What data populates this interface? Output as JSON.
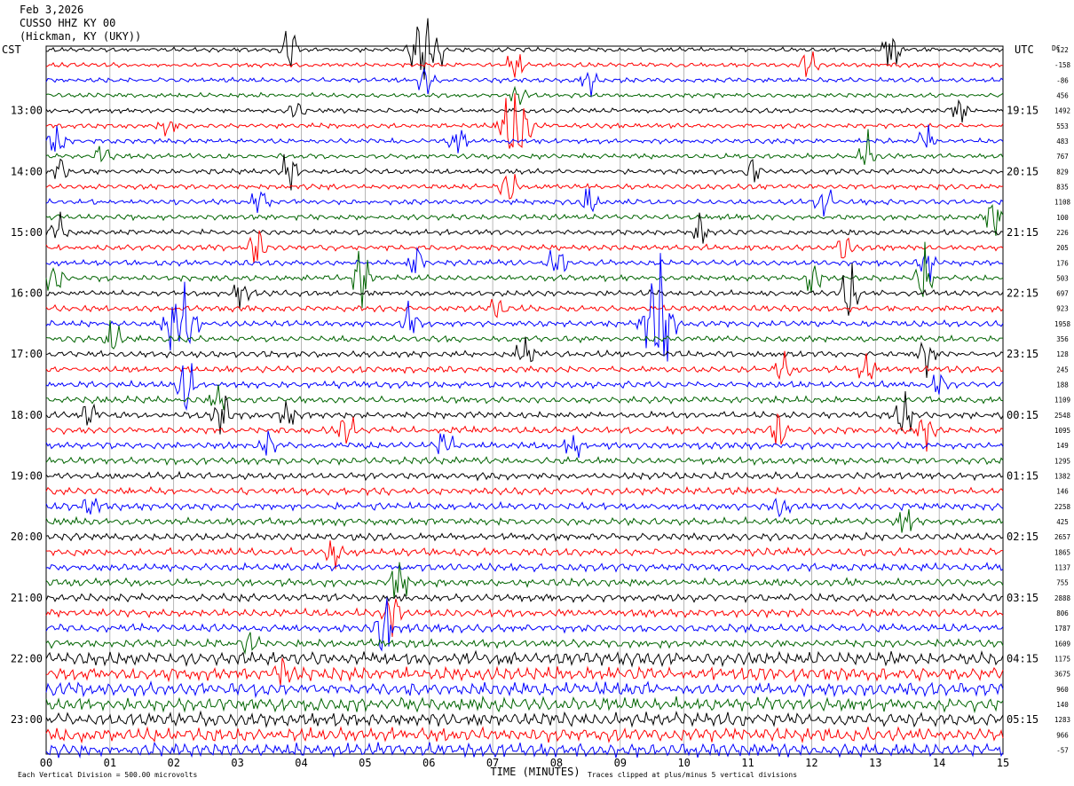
{
  "header": {
    "date": "Feb 3,2026",
    "station": "CUSSO HHZ KY 00",
    "location": "(Hickman, KY (UKY))"
  },
  "labels": {
    "left_zone": "CST",
    "right_zone": "UTC",
    "dc_header": "DC",
    "xlabel": "TIME (MINUTES)",
    "footer_left": "Each Vertical Division =  500.00 microvolts",
    "footer_right": "Traces clipped at plus/minus 5 vertical divisions"
  },
  "chart_data": {
    "type": "line",
    "title": "",
    "xlabel": "TIME (MINUTES)",
    "xlim": [
      0,
      15
    ],
    "x_ticks": [
      "00",
      "01",
      "02",
      "03",
      "04",
      "05",
      "06",
      "07",
      "08",
      "09",
      "10",
      "11",
      "12",
      "13",
      "14",
      "15"
    ],
    "trace_colors": [
      "#000000",
      "#ff0000",
      "#0000ff",
      "#006400"
    ],
    "left_hour_labels": [
      {
        "row": 4,
        "label": "13:00"
      },
      {
        "row": 8,
        "label": "14:00"
      },
      {
        "row": 12,
        "label": "15:00"
      },
      {
        "row": 16,
        "label": "16:00"
      },
      {
        "row": 20,
        "label": "17:00"
      },
      {
        "row": 24,
        "label": "18:00"
      },
      {
        "row": 28,
        "label": "19:00"
      },
      {
        "row": 32,
        "label": "20:00"
      },
      {
        "row": 36,
        "label": "21:00"
      },
      {
        "row": 40,
        "label": "22:00"
      },
      {
        "row": 44,
        "label": "23:00"
      }
    ],
    "right_hour_labels": [
      {
        "row": 4,
        "label": "19:15"
      },
      {
        "row": 8,
        "label": "20:15"
      },
      {
        "row": 12,
        "label": "21:15"
      },
      {
        "row": 16,
        "label": "22:15"
      },
      {
        "row": 20,
        "label": "23:15"
      },
      {
        "row": 24,
        "label": "00:15"
      },
      {
        "row": 28,
        "label": "01:15"
      },
      {
        "row": 32,
        "label": "02:15"
      },
      {
        "row": 36,
        "label": "03:15"
      },
      {
        "row": 40,
        "label": "04:15"
      },
      {
        "row": 44,
        "label": "05:15"
      }
    ],
    "dc_offsets": [
      "122",
      "-158",
      "-86",
      "456",
      "1492",
      "553",
      "483",
      "767",
      "829",
      "835",
      "1108",
      "100",
      "226",
      "205",
      "176",
      "503",
      "697",
      "923",
      "1958",
      "356",
      "128",
      "245",
      "188",
      "1109",
      "2548",
      "1095",
      "149",
      "1295",
      "1382",
      "146",
      "2258",
      "425",
      "2657",
      "1865",
      "1137",
      "755",
      "2888",
      "806",
      "1787",
      "1609",
      "1175",
      "3675",
      "960",
      "140",
      "1283",
      "966",
      "-57"
    ],
    "traces_count": 47,
    "events": [
      {
        "row": 0,
        "minute": 3.8,
        "amp": 2.5
      },
      {
        "row": 0,
        "minute": 5.95,
        "amp": 3.0
      },
      {
        "row": 0,
        "minute": 13.25,
        "amp": 2.0
      },
      {
        "row": 1,
        "minute": 7.35,
        "amp": 1.5
      },
      {
        "row": 1,
        "minute": 11.95,
        "amp": 1.2
      },
      {
        "row": 2,
        "minute": 5.95,
        "amp": 1.2
      },
      {
        "row": 2,
        "minute": 8.5,
        "amp": 1.5
      },
      {
        "row": 3,
        "minute": 7.4,
        "amp": 1.0
      },
      {
        "row": 4,
        "minute": 3.95,
        "amp": 1.4
      },
      {
        "row": 4,
        "minute": 14.3,
        "amp": 1.0
      },
      {
        "row": 5,
        "minute": 1.9,
        "amp": 1.0
      },
      {
        "row": 5,
        "minute": 7.35,
        "amp": 3.5
      },
      {
        "row": 6,
        "minute": 0.15,
        "amp": 1.2
      },
      {
        "row": 6,
        "minute": 6.45,
        "amp": 1.2
      },
      {
        "row": 6,
        "minute": 13.8,
        "amp": 1.5
      },
      {
        "row": 7,
        "minute": 0.9,
        "amp": 1.0
      },
      {
        "row": 7,
        "minute": 12.85,
        "amp": 1.8
      },
      {
        "row": 8,
        "minute": 0.2,
        "amp": 1.5
      },
      {
        "row": 8,
        "minute": 3.8,
        "amp": 1.6
      },
      {
        "row": 8,
        "minute": 11.1,
        "amp": 1.2
      },
      {
        "row": 9,
        "minute": 7.25,
        "amp": 1.4
      },
      {
        "row": 10,
        "minute": 3.35,
        "amp": 1.4
      },
      {
        "row": 10,
        "minute": 8.5,
        "amp": 1.4
      },
      {
        "row": 10,
        "minute": 12.2,
        "amp": 1.6
      },
      {
        "row": 11,
        "minute": 14.85,
        "amp": 1.4
      },
      {
        "row": 12,
        "minute": 0.2,
        "amp": 1.4
      },
      {
        "row": 12,
        "minute": 10.25,
        "amp": 1.5
      },
      {
        "row": 13,
        "minute": 3.3,
        "amp": 2.0
      },
      {
        "row": 13,
        "minute": 12.5,
        "amp": 1.2
      },
      {
        "row": 14,
        "minute": 5.8,
        "amp": 1.6
      },
      {
        "row": 14,
        "minute": 8.0,
        "amp": 1.6
      },
      {
        "row": 14,
        "minute": 13.8,
        "amp": 1.4
      },
      {
        "row": 15,
        "minute": 0.15,
        "amp": 1.6
      },
      {
        "row": 15,
        "minute": 4.95,
        "amp": 2.5
      },
      {
        "row": 15,
        "minute": 12.0,
        "amp": 1.4
      },
      {
        "row": 15,
        "minute": 13.75,
        "amp": 2.6
      },
      {
        "row": 16,
        "minute": 3.05,
        "amp": 1.2
      },
      {
        "row": 16,
        "minute": 12.6,
        "amp": 2.0
      },
      {
        "row": 17,
        "minute": 7.1,
        "amp": 1.2
      },
      {
        "row": 18,
        "minute": 5.7,
        "amp": 1.6
      },
      {
        "row": 18,
        "minute": 9.6,
        "amp": 5.0
      },
      {
        "row": 18,
        "minute": 2.1,
        "amp": 3.0
      },
      {
        "row": 19,
        "minute": 1.05,
        "amp": 1.4
      },
      {
        "row": 20,
        "minute": 7.5,
        "amp": 1.4
      },
      {
        "row": 20,
        "minute": 13.8,
        "amp": 1.4
      },
      {
        "row": 21,
        "minute": 11.55,
        "amp": 1.8
      },
      {
        "row": 21,
        "minute": 12.85,
        "amp": 1.2
      },
      {
        "row": 22,
        "minute": 2.2,
        "amp": 2.5
      },
      {
        "row": 22,
        "minute": 14.0,
        "amp": 1.4
      },
      {
        "row": 23,
        "minute": 2.7,
        "amp": 1.4
      },
      {
        "row": 24,
        "minute": 0.65,
        "amp": 1.4
      },
      {
        "row": 24,
        "minute": 2.75,
        "amp": 2.0
      },
      {
        "row": 24,
        "minute": 3.8,
        "amp": 1.2
      },
      {
        "row": 24,
        "minute": 13.45,
        "amp": 1.6
      },
      {
        "row": 25,
        "minute": 4.7,
        "amp": 1.6
      },
      {
        "row": 25,
        "minute": 11.5,
        "amp": 1.8
      },
      {
        "row": 25,
        "minute": 13.8,
        "amp": 1.4
      },
      {
        "row": 26,
        "minute": 3.45,
        "amp": 1.2
      },
      {
        "row": 26,
        "minute": 6.25,
        "amp": 1.2
      },
      {
        "row": 26,
        "minute": 8.25,
        "amp": 1.2
      },
      {
        "row": 30,
        "minute": 0.7,
        "amp": 1.0
      },
      {
        "row": 30,
        "minute": 11.5,
        "amp": 1.0
      },
      {
        "row": 31,
        "minute": 13.45,
        "amp": 1.5
      },
      {
        "row": 33,
        "minute": 4.5,
        "amp": 1.2
      },
      {
        "row": 35,
        "minute": 5.55,
        "amp": 2.5
      },
      {
        "row": 37,
        "minute": 5.4,
        "amp": 2.2
      },
      {
        "row": 38,
        "minute": 5.3,
        "amp": 2.4
      },
      {
        "row": 39,
        "minute": 3.2,
        "amp": 0.8
      },
      {
        "row": 41,
        "minute": 3.7,
        "amp": 1.0
      }
    ]
  }
}
